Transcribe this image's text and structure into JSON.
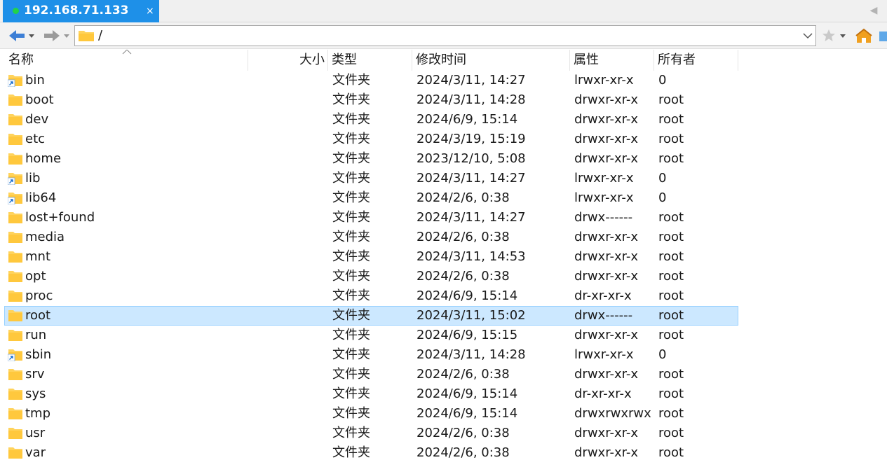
{
  "tab": {
    "title": "192.168.71.133",
    "close": "×"
  },
  "addressbar": {
    "path": "/"
  },
  "columns": {
    "name": "名称",
    "size": "大小",
    "type": "类型",
    "modified": "修改时间",
    "attributes": "属性",
    "owner": "所有者"
  },
  "colors": {
    "tab_bg": "#1e90e8",
    "status_dot": "#22d34a",
    "selection_bg": "#cce8ff",
    "selection_border": "#99d1ff",
    "folder_yellow": "#ffd35c",
    "link_arrow": "#1a6fd1"
  },
  "rows": [
    {
      "name": "bin",
      "type": "文件夹",
      "modified": "2024/3/11, 14:27",
      "attributes": "lrwxr-xr-x",
      "owner": "0",
      "link": true
    },
    {
      "name": "boot",
      "type": "文件夹",
      "modified": "2024/3/11, 14:28",
      "attributes": "drwxr-xr-x",
      "owner": "root",
      "link": false
    },
    {
      "name": "dev",
      "type": "文件夹",
      "modified": "2024/6/9, 15:14",
      "attributes": "drwxr-xr-x",
      "owner": "root",
      "link": false
    },
    {
      "name": "etc",
      "type": "文件夹",
      "modified": "2024/3/19, 15:19",
      "attributes": "drwxr-xr-x",
      "owner": "root",
      "link": false
    },
    {
      "name": "home",
      "type": "文件夹",
      "modified": "2023/12/10, 5:08",
      "attributes": "drwxr-xr-x",
      "owner": "root",
      "link": false
    },
    {
      "name": "lib",
      "type": "文件夹",
      "modified": "2024/3/11, 14:27",
      "attributes": "lrwxr-xr-x",
      "owner": "0",
      "link": true
    },
    {
      "name": "lib64",
      "type": "文件夹",
      "modified": "2024/2/6, 0:38",
      "attributes": "lrwxr-xr-x",
      "owner": "0",
      "link": true
    },
    {
      "name": "lost+found",
      "type": "文件夹",
      "modified": "2024/3/11, 14:27",
      "attributes": "drwx------",
      "owner": "root",
      "link": false
    },
    {
      "name": "media",
      "type": "文件夹",
      "modified": "2024/2/6, 0:38",
      "attributes": "drwxr-xr-x",
      "owner": "root",
      "link": false
    },
    {
      "name": "mnt",
      "type": "文件夹",
      "modified": "2024/3/11, 14:53",
      "attributes": "drwxr-xr-x",
      "owner": "root",
      "link": false
    },
    {
      "name": "opt",
      "type": "文件夹",
      "modified": "2024/2/6, 0:38",
      "attributes": "drwxr-xr-x",
      "owner": "root",
      "link": false
    },
    {
      "name": "proc",
      "type": "文件夹",
      "modified": "2024/6/9, 15:14",
      "attributes": "dr-xr-xr-x",
      "owner": "root",
      "link": false
    },
    {
      "name": "root",
      "type": "文件夹",
      "modified": "2024/3/11, 15:02",
      "attributes": "drwx------",
      "owner": "root",
      "link": false,
      "selected": true
    },
    {
      "name": "run",
      "type": "文件夹",
      "modified": "2024/6/9, 15:15",
      "attributes": "drwxr-xr-x",
      "owner": "root",
      "link": false
    },
    {
      "name": "sbin",
      "type": "文件夹",
      "modified": "2024/3/11, 14:28",
      "attributes": "lrwxr-xr-x",
      "owner": "0",
      "link": true
    },
    {
      "name": "srv",
      "type": "文件夹",
      "modified": "2024/2/6, 0:38",
      "attributes": "drwxr-xr-x",
      "owner": "root",
      "link": false
    },
    {
      "name": "sys",
      "type": "文件夹",
      "modified": "2024/6/9, 15:14",
      "attributes": "dr-xr-xr-x",
      "owner": "root",
      "link": false
    },
    {
      "name": "tmp",
      "type": "文件夹",
      "modified": "2024/6/9, 15:14",
      "attributes": "drwxrwxrwx",
      "owner": "root",
      "link": false
    },
    {
      "name": "usr",
      "type": "文件夹",
      "modified": "2024/2/6, 0:38",
      "attributes": "drwxr-xr-x",
      "owner": "root",
      "link": false
    },
    {
      "name": "var",
      "type": "文件夹",
      "modified": "2024/2/6, 0:38",
      "attributes": "drwxr-xr-x",
      "owner": "root",
      "link": false
    }
  ]
}
